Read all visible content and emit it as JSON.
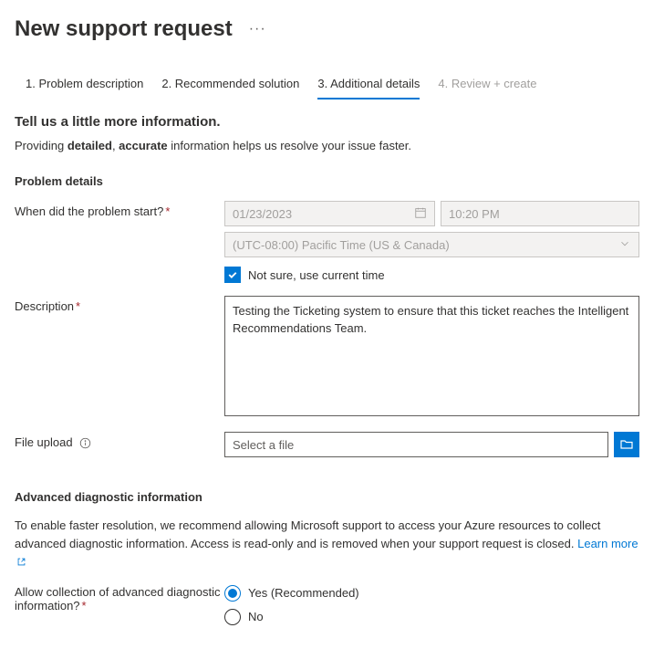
{
  "header": {
    "title": "New support request"
  },
  "tabs": [
    {
      "label": "1. Problem description"
    },
    {
      "label": "2. Recommended solution"
    },
    {
      "label": "3. Additional details"
    },
    {
      "label": "4. Review + create"
    }
  ],
  "intro": {
    "heading": "Tell us a little more information.",
    "text_prefix": "Providing ",
    "text_bold1": "detailed",
    "text_sep": ", ",
    "text_bold2": "accurate",
    "text_suffix": " information helps us resolve your issue faster."
  },
  "problem_details": {
    "title": "Problem details",
    "when_label": "When did the problem start?",
    "date_value": "01/23/2023",
    "time_value": "10:20 PM",
    "timezone_value": "(UTC-08:00) Pacific Time (US & Canada)",
    "checkbox_label": "Not sure, use current time",
    "description_label": "Description",
    "description_value": "Testing the Ticketing system to ensure that this ticket reaches the Intelligent Recommendations Team.",
    "file_label": "File upload",
    "file_placeholder": "Select a file"
  },
  "advanced": {
    "title": "Advanced diagnostic information",
    "text": "To enable faster resolution, we recommend allowing Microsoft support to access your Azure resources to collect advanced diagnostic information. Access is read-only and is removed when your support request is closed. ",
    "learn_more": "Learn more",
    "allow_label": "Allow collection of advanced diagnostic information?",
    "options": {
      "yes": "Yes (Recommended)",
      "no": "No"
    }
  }
}
